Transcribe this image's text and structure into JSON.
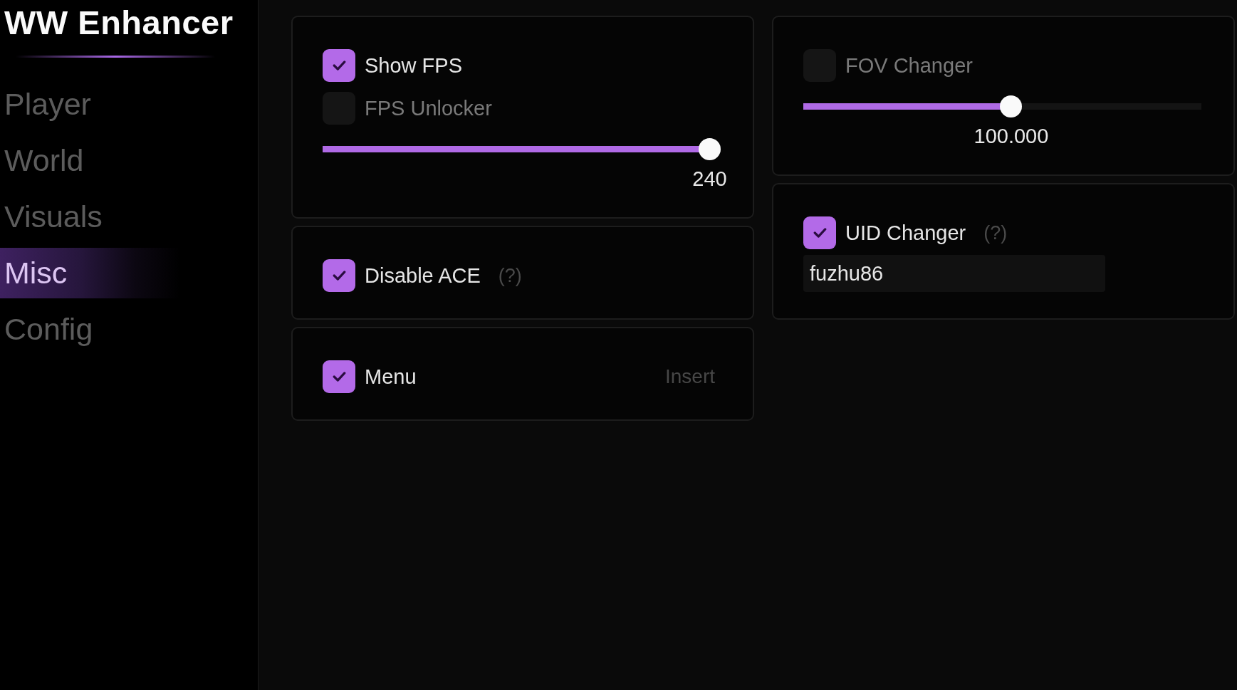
{
  "sidebar": {
    "title": "WW Enhancer",
    "items": [
      {
        "label": "Player",
        "selected": false
      },
      {
        "label": "World",
        "selected": false
      },
      {
        "label": "Visuals",
        "selected": false
      },
      {
        "label": "Misc",
        "selected": true
      },
      {
        "label": "Config",
        "selected": false
      }
    ]
  },
  "columns": [
    {
      "cards": [
        {
          "items": [
            {
              "kind": "checkbox",
              "label": "Show FPS",
              "checked": true
            },
            {
              "kind": "checkbox",
              "label": "FPS Unlocker",
              "checked": false
            },
            {
              "kind": "slider",
              "level": 1,
              "reading": "240"
            }
          ]
        },
        {
          "items": [
            {
              "kind": "checkbox",
              "label": "Disable ACE",
              "checked": true,
              "hint": "(?)"
            }
          ]
        },
        {
          "items": [
            {
              "kind": "checkbox",
              "label": "Menu",
              "checked": true,
              "keybind": "Insert"
            }
          ]
        }
      ]
    },
    {
      "cards": [
        {
          "items": [
            {
              "kind": "checkbox",
              "label": "FOV Changer",
              "checked": false
            },
            {
              "kind": "slider",
              "level": 0.55,
              "reading": "100.000"
            }
          ]
        },
        {
          "items": [
            {
              "kind": "checkbox",
              "label": "UID Changer",
              "checked": true,
              "hint": "(?)"
            },
            {
              "kind": "text_field",
              "value": "fuzhu86"
            }
          ]
        }
      ]
    }
  ]
}
